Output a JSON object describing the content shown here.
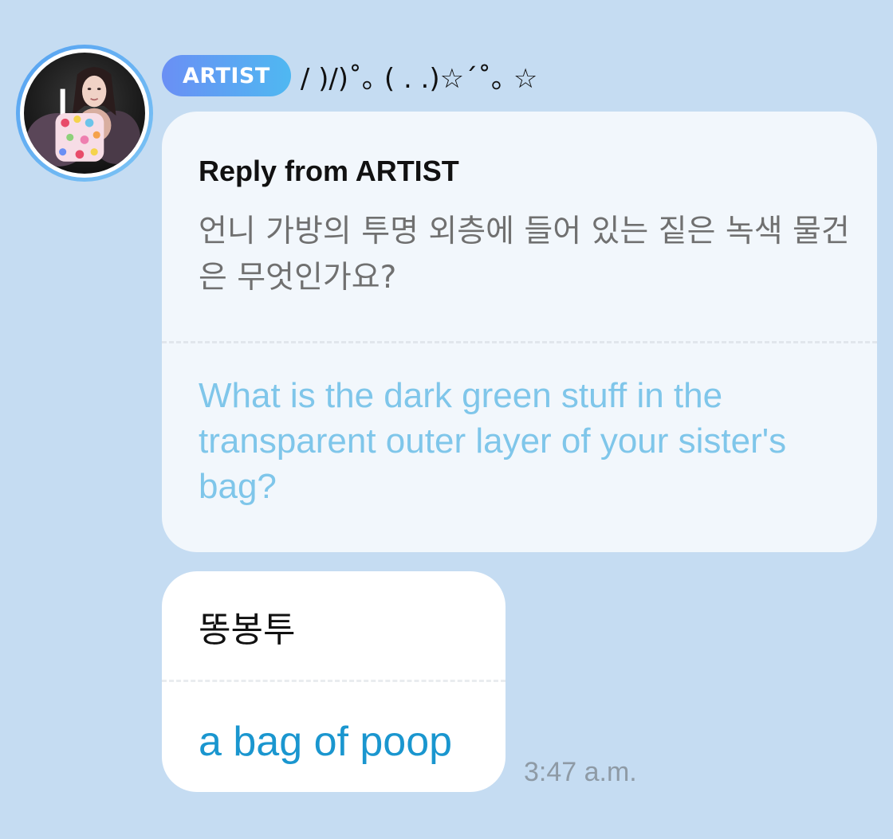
{
  "author": {
    "badge": "ARTIST",
    "display_name": "/ )/)˚｡  ( . .)☆´˚｡ ☆",
    "avatar_icon": "avatar-photo-icon"
  },
  "reply_card": {
    "title": "Reply from ARTIST",
    "original_text": "언니 가방의 투명 외층에 들어 있는 짙은 녹색 물건은 무엇인가요?",
    "translation": "What is the dark green stuff in the transparent outer layer of your sister's bag?"
  },
  "message": {
    "original_text": "똥봉투",
    "translation": "a bag of poop",
    "timestamp": "3:47 a.m."
  },
  "colors": {
    "background": "#c5dcf2",
    "badge_gradient_start": "#6a8ff4",
    "badge_gradient_end": "#4fb8f2",
    "reply_card_bg": "#f2f7fc",
    "reply_translation": "#7fc6ea",
    "message_translation": "#1a96cf",
    "timestamp": "#8e9aa5"
  }
}
